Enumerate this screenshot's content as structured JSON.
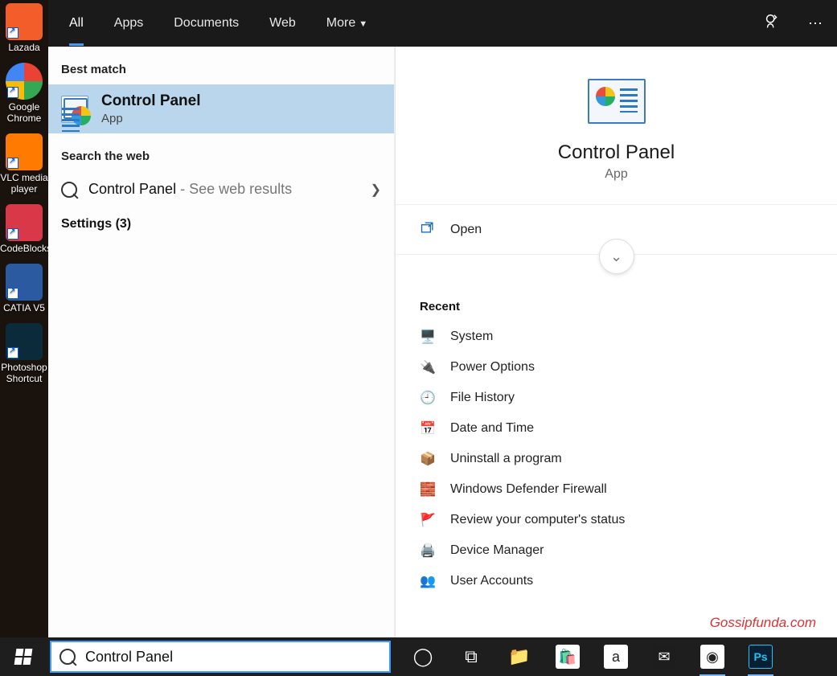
{
  "desktop": {
    "items": [
      {
        "label": "Lazada",
        "color": "#f25d2a"
      },
      {
        "label": "Google Chrome",
        "color": "radial"
      },
      {
        "label": "VLC media player",
        "color": "#ff7a00"
      },
      {
        "label": "CodeBlocks",
        "color": "#d93848"
      },
      {
        "label": "CATIA V5",
        "color": "#2b5aa0"
      },
      {
        "label": "Photoshop Shortcut",
        "color": "#0b2a3a"
      }
    ]
  },
  "tabs": {
    "items": [
      "All",
      "Apps",
      "Documents",
      "Web",
      "More"
    ],
    "active_index": 0
  },
  "results": {
    "best_match_header": "Best match",
    "best_match": {
      "title": "Control Panel",
      "subtitle": "App"
    },
    "web_header": "Search the web",
    "web_query": "Control Panel",
    "web_suffix": " - See web results",
    "settings_label": "Settings (3)"
  },
  "detail": {
    "title": "Control Panel",
    "subtitle": "App",
    "open_label": "Open",
    "recent_header": "Recent",
    "recent": [
      {
        "label": "System",
        "icon": "🖥️"
      },
      {
        "label": "Power Options",
        "icon": "🔌"
      },
      {
        "label": "File History",
        "icon": "🕘"
      },
      {
        "label": "Date and Time",
        "icon": "📅"
      },
      {
        "label": "Uninstall a program",
        "icon": "📦"
      },
      {
        "label": "Windows Defender Firewall",
        "icon": "🧱"
      },
      {
        "label": "Review your computer's status",
        "icon": "🚩"
      },
      {
        "label": "Device Manager",
        "icon": "🖨️"
      },
      {
        "label": "User Accounts",
        "icon": "👥"
      }
    ]
  },
  "search_input": {
    "value": "Control Panel"
  },
  "watermark": "Gossipfunda.com",
  "taskbar_icons": [
    {
      "name": "cortana-icon",
      "glyph": "◯",
      "bg": "transparent"
    },
    {
      "name": "taskview-icon",
      "glyph": "⧉",
      "bg": "transparent"
    },
    {
      "name": "explorer-icon",
      "glyph": "📁",
      "bg": "transparent"
    },
    {
      "name": "store-icon",
      "glyph": "🛍️",
      "bg": "#ffffff"
    },
    {
      "name": "amazon-icon",
      "glyph": "a",
      "bg": "#ffffff"
    },
    {
      "name": "mail-icon",
      "glyph": "✉",
      "bg": "#1d1d1d"
    },
    {
      "name": "chrome-icon",
      "glyph": "◉",
      "bg": "#ffffff"
    },
    {
      "name": "photoshop-icon",
      "glyph": "Ps",
      "bg": "#072033"
    }
  ]
}
